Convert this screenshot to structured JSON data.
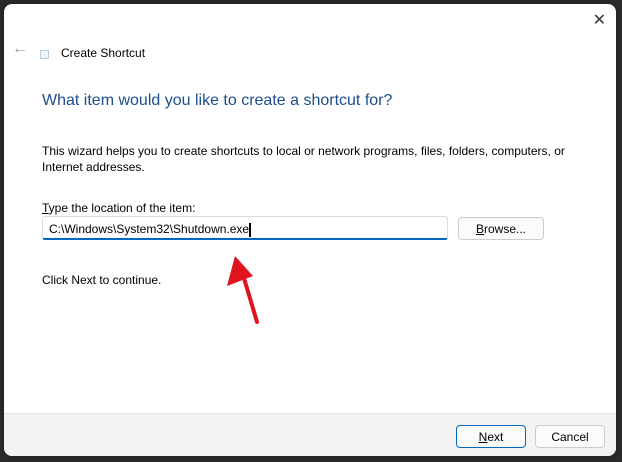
{
  "window": {
    "title": "Create Shortcut"
  },
  "wizard": {
    "heading": "What item would you like to create a shortcut for?",
    "description": "This wizard helps you to create shortcuts to local or network programs, files, folders, computers, or Internet addresses.",
    "location_label_mnemonic": "T",
    "location_label_rest": "ype the location of the item:",
    "location_value": "C:\\Windows\\System32\\Shutdown.exe",
    "browse_mnemonic": "B",
    "browse_rest": "rowse...",
    "continue_text": "Click Next to continue."
  },
  "footer": {
    "next_mnemonic": "N",
    "next_rest": "ext",
    "cancel": "Cancel"
  },
  "colors": {
    "accent": "#0067c0",
    "heading": "#1c4e8a",
    "annotation_arrow": "#e0141e"
  }
}
